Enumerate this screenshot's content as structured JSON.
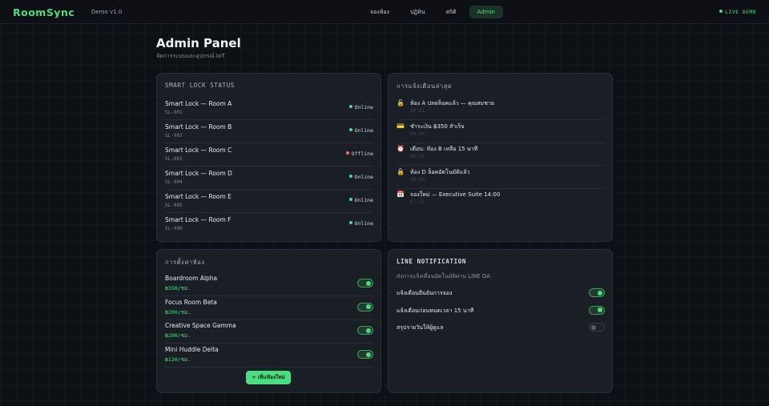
{
  "header": {
    "logo": "RoomSync",
    "version": "Demo v1.0",
    "nav": [
      "จองห้อง",
      "ปฏิทิน",
      "สถิติ",
      "Admin"
    ],
    "nav_active": "Admin",
    "live_label": "LIVE DEMO"
  },
  "page": {
    "title": "Admin Panel",
    "subtitle": "จัดการระบบและอุปกรณ์ IoT"
  },
  "locks": {
    "title": "SMART LOCK STATUS",
    "items": [
      {
        "name": "Smart Lock — Room A",
        "id": "SL-001",
        "status": "Online"
      },
      {
        "name": "Smart Lock — Room B",
        "id": "SL-002",
        "status": "Online"
      },
      {
        "name": "Smart Lock — Room C",
        "id": "SL-003",
        "status": "Offline"
      },
      {
        "name": "Smart Lock — Room D",
        "id": "SL-004",
        "status": "Online"
      },
      {
        "name": "Smart Lock — Room E",
        "id": "SL-005",
        "status": "Online"
      },
      {
        "name": "Smart Lock — Room F",
        "id": "SL-006",
        "status": "Online"
      }
    ],
    "colors": {
      "online": "#4ade80",
      "offline": "#f87171"
    }
  },
  "notifications": {
    "title": "การแจ้งเตือนล่าสุด",
    "items": [
      {
        "icon": "unlock-icon",
        "text": "ห้อง A ปลดล็อคแล้ว — คุณสมชาย",
        "time": "09:01"
      },
      {
        "icon": "credit-card-icon",
        "text": "ชำระเงิน ฿350 สำเร็จ",
        "time": "09:00"
      },
      {
        "icon": "alarm-clock-icon",
        "text": "เตือน: ห้อง B เหลือ 15 นาที",
        "time": "08:45"
      },
      {
        "icon": "lock-icon",
        "text": "ห้อง D ล็อคอัตโนมัติแล้ว",
        "time": "08:40"
      },
      {
        "icon": "calendar-icon",
        "text": "จองใหม่ — Executive Suite 14:00",
        "time": "07:33"
      }
    ]
  },
  "rooms": {
    "title": "การตั้งค่าห้อง",
    "items": [
      {
        "name": "Boardroom Alpha",
        "price": "฿350/ชม.",
        "enabled": true
      },
      {
        "name": "Focus Room Beta",
        "price": "฿200/ชม.",
        "enabled": true
      },
      {
        "name": "Creative Space Gamma",
        "price": "฿280/ชม.",
        "enabled": true
      },
      {
        "name": "Mini Huddle Delta",
        "price": "฿120/ชม.",
        "enabled": true
      }
    ],
    "add_label": "+ เพิ่มห้องใหม่"
  },
  "line": {
    "title": "LINE NOTIFICATION",
    "description": "ส่งการแจ้งเตือนอัตโนมัติผ่าน LINE OA",
    "settings": [
      {
        "label": "แจ้งเตือนยืนยันการจอง",
        "enabled": true
      },
      {
        "label": "แจ้งเตือนก่อนหมดเวลา 15 นาที",
        "enabled": true
      },
      {
        "label": "สรุปรายวันให้ผู้ดูแล",
        "enabled": false
      }
    ]
  },
  "colors": {
    "accent": "#4ade80",
    "card": "#1a1e25",
    "background": "#0d1014"
  }
}
